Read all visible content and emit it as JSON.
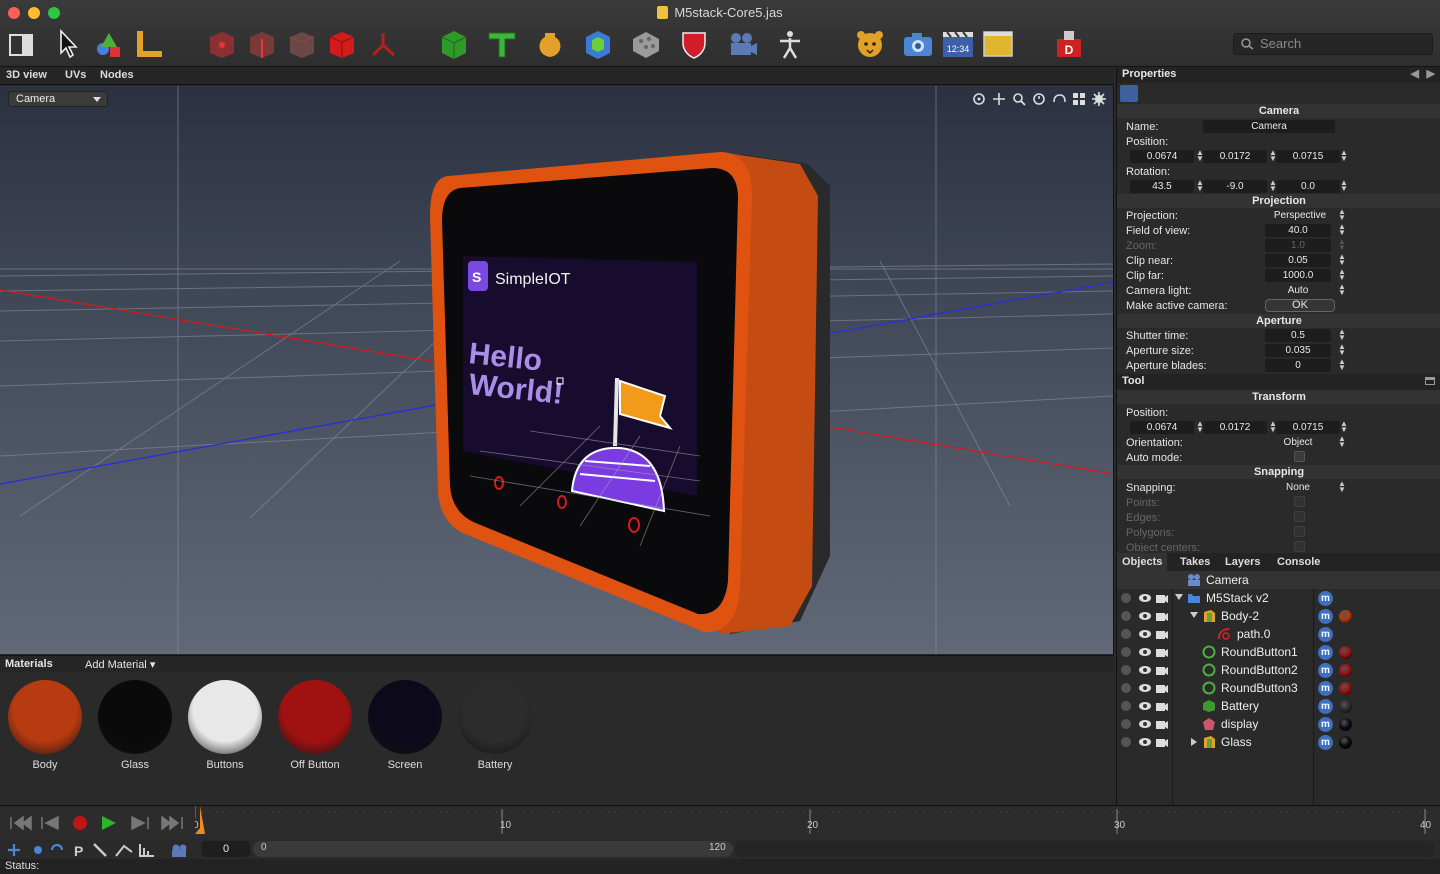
{
  "window": {
    "title": "M5stack-Core5.jas"
  },
  "toolbar": {
    "tools": [
      {
        "name": "layout-icon"
      },
      {
        "name": "pointer-icon"
      },
      {
        "name": "shapes-icon"
      },
      {
        "name": "ruler-icon"
      },
      {
        "name": "vertex-mode-icon"
      },
      {
        "name": "edge-mode-icon"
      },
      {
        "name": "face-mode-icon"
      },
      {
        "name": "object-mode-icon"
      },
      {
        "name": "skeleton-mode-icon"
      },
      {
        "name": "cube-icon"
      },
      {
        "name": "text-icon"
      },
      {
        "name": "vase-icon"
      },
      {
        "name": "box-icon"
      },
      {
        "name": "sponge-icon"
      },
      {
        "name": "shield-icon"
      },
      {
        "name": "camera-object-icon"
      },
      {
        "name": "figure-icon"
      },
      {
        "name": "cheetah-icon"
      },
      {
        "name": "snapshot-camera-icon"
      },
      {
        "name": "clapper-icon"
      },
      {
        "name": "window-icon"
      },
      {
        "name": "export-icon"
      }
    ],
    "search_placeholder": "Search",
    "clapper_text": "12:34"
  },
  "view_tabs": [
    "3D view",
    "UVs",
    "Nodes"
  ],
  "viewport": {
    "camera_select": "Camera",
    "screen_brand": "SimpleIOT",
    "screen_text_line1": "Hello",
    "screen_text_line2": "World!"
  },
  "materials": {
    "header": "Materials",
    "add_label": "Add Material",
    "items": [
      {
        "label": "Body",
        "color": "#b83a10"
      },
      {
        "label": "Glass",
        "color": "#0a0a0a"
      },
      {
        "label": "Buttons",
        "color": "#e8e8e8"
      },
      {
        "label": "Off Button",
        "color": "#a01212"
      },
      {
        "label": "Screen",
        "color": "#0c0a1a"
      },
      {
        "label": "Battery",
        "color": "#2c2c2c"
      }
    ]
  },
  "timeline": {
    "ticks": [
      "0",
      "10",
      "20",
      "30",
      "40"
    ],
    "frame_field": "0",
    "range_start": "0",
    "range_end": "120"
  },
  "status": "Status:",
  "properties": {
    "header": "Properties",
    "camera_section": "Camera",
    "name_label": "Name:",
    "name_value": "Camera",
    "position_label": "Position:",
    "position": [
      "0.0674",
      "0.0172",
      "0.0715"
    ],
    "rotation_label": "Rotation:",
    "rotation": [
      "43.5",
      "-9.0",
      "0.0"
    ],
    "projection_section": "Projection",
    "projection_label": "Projection:",
    "projection_value": "Perspective",
    "fov_label": "Field of view:",
    "fov_value": "40.0",
    "zoom_label": "Zoom:",
    "zoom_value": "1.0",
    "clip_near_label": "Clip near:",
    "clip_near_value": "0.05",
    "clip_far_label": "Clip far:",
    "clip_far_value": "1000.0",
    "camera_light_label": "Camera light:",
    "camera_light_value": "Auto",
    "active_label": "Make active camera:",
    "ok_label": "OK",
    "aperture_section": "Aperture",
    "shutter_label": "Shutter time:",
    "shutter_value": "0.5",
    "aperture_size_label": "Aperture size:",
    "aperture_size_value": "0.035",
    "blades_label": "Aperture blades:",
    "blades_value": "0"
  },
  "tool": {
    "header": "Tool",
    "transform_section": "Transform",
    "position_label": "Position:",
    "position": [
      "0.0674",
      "0.0172",
      "0.0715"
    ],
    "orientation_label": "Orientation:",
    "orientation_value": "Object",
    "auto_mode_label": "Auto mode:",
    "snapping_section": "Snapping",
    "snapping_label": "Snapping:",
    "snapping_value": "None",
    "points_label": "Points:",
    "edges_label": "Edges:",
    "polygons_label": "Polygons:",
    "object_centers_label": "Object centers:"
  },
  "objects": {
    "tabs": [
      "Objects",
      "Takes",
      "Layers",
      "Console"
    ],
    "items": [
      {
        "name": "Camera",
        "icon": "camera-icon",
        "material_color": ""
      },
      {
        "name": "M5Stack v2",
        "icon": "folder-icon",
        "material_color": ""
      },
      {
        "name": "Body-2",
        "icon": "body-icon",
        "material_color": "#b83a10"
      },
      {
        "name": "path.0",
        "icon": "path-icon",
        "material_color": ""
      },
      {
        "name": "RoundButton1",
        "icon": "ring-icon",
        "material_color": "#a01212"
      },
      {
        "name": "RoundButton2",
        "icon": "ring-icon",
        "material_color": "#a01212"
      },
      {
        "name": "RoundButton3",
        "icon": "ring-icon",
        "material_color": "#a01212"
      },
      {
        "name": "Battery",
        "icon": "cube-icon",
        "material_color": "#2c2c2c"
      },
      {
        "name": "display",
        "icon": "polygon-icon",
        "material_color": "#0c0a1a"
      },
      {
        "name": "Glass",
        "icon": "body-icon",
        "material_color": "#0a0a0a"
      }
    ]
  }
}
